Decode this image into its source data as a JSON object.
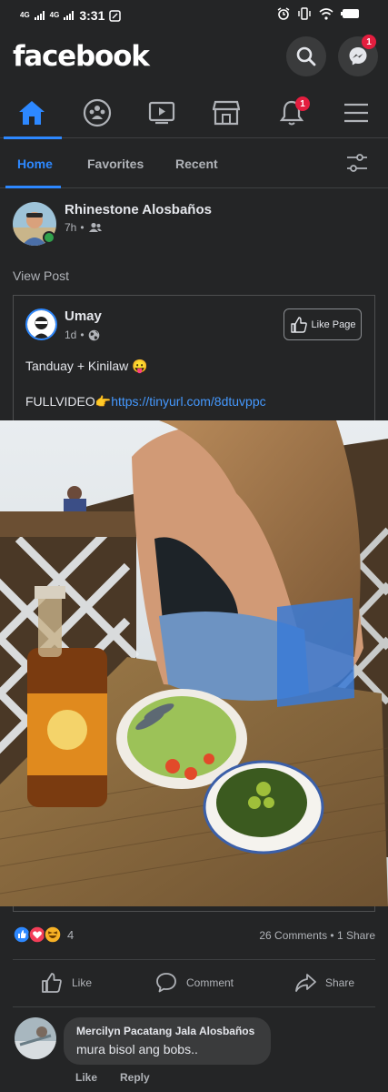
{
  "status_bar": {
    "network1": "4G",
    "network2": "4G",
    "time": "3:31"
  },
  "header": {
    "logo": "facebook",
    "messenger_badge": "1"
  },
  "nav": {
    "notifications_badge": "1",
    "icons": [
      "home-icon",
      "groups-icon",
      "watch-icon",
      "marketplace-icon",
      "notifications-icon",
      "menu-icon"
    ],
    "active_color": "#2d88ff"
  },
  "feed_tabs": {
    "home": "Home",
    "favorites": "Favorites",
    "recent": "Recent"
  },
  "post": {
    "author": "Rhinestone Alosbaños",
    "time": "7h",
    "view_post": "View Post",
    "shared": {
      "page_name": "Umay",
      "time": "1d",
      "like_page_label": "Like Page",
      "text_line1": "Tanduay + Kinilaw 😛",
      "text_prefix": "FULLVIDEO👉",
      "link": "https://tinyurl.com/8dtuvppc"
    },
    "reaction_count": "4",
    "comments_count": "26 Comments",
    "shares_count": "1 Share",
    "actions": {
      "like": "Like",
      "comment": "Comment",
      "share": "Share"
    }
  },
  "comment": {
    "author": "Mercilyn Pacatang Jala Alosbaños",
    "text": "mura bisol ang bobs..",
    "like": "Like",
    "reply": "Reply"
  }
}
